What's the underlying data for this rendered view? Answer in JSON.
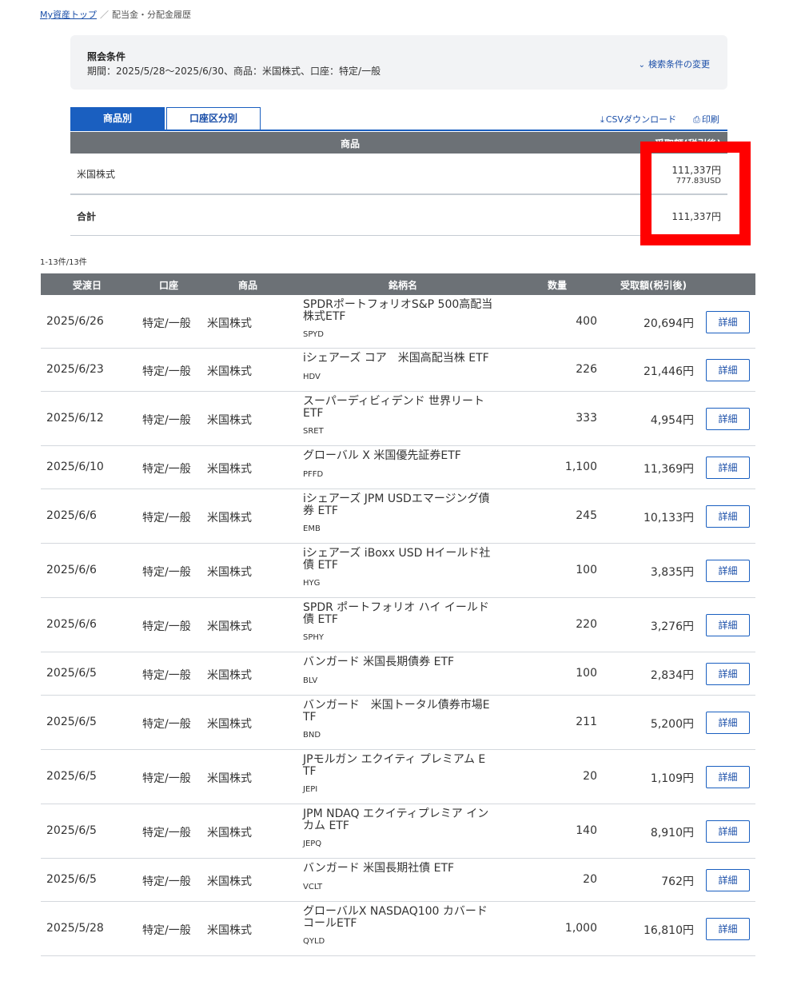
{
  "breadcrumb": {
    "home": "My資産トップ",
    "separator": "／",
    "current": "配当金・分配金履歴"
  },
  "conditions": {
    "title": "照会条件",
    "text": "期間：2025/5/28～2025/6/30、商品：米国株式、口座：特定/一般",
    "change_label": "検索条件の変更"
  },
  "tabs": [
    {
      "label": "商品別",
      "active": true
    },
    {
      "label": "口座区分別",
      "active": false
    }
  ],
  "actions": {
    "csv_label": "CSVダウンロード",
    "print_label": "印刷"
  },
  "summary": {
    "col_product": "商品",
    "col_amount": "受取額(税引後)",
    "row_product": "米国株式",
    "row_amount_jpy": "111,337円",
    "row_amount_usd": "777.83USD",
    "total_label": "合計",
    "total_amount": "111,337円"
  },
  "list": {
    "count": "1-13件/13件",
    "headers": {
      "date": "受渡日",
      "account": "口座",
      "product": "商品",
      "name": "銘柄名",
      "qty": "数量",
      "amount": "受取額(税引後)"
    },
    "detail_label": "詳細",
    "rows": [
      {
        "date": "2025/6/26",
        "account": "特定/一般",
        "product": "米国株式",
        "name1": "SPDRポートフォリオS&P 500高配当",
        "name2": "株式ETF",
        "code": "SPYD",
        "qty": "400",
        "amount": "20,694円"
      },
      {
        "date": "2025/6/23",
        "account": "特定/一般",
        "product": "米国株式",
        "name1": "iシェアーズ コア　米国高配当株 ETF",
        "name2": "",
        "code": "HDV",
        "qty": "226",
        "amount": "21,446円"
      },
      {
        "date": "2025/6/12",
        "account": "特定/一般",
        "product": "米国株式",
        "name1": "スーパーディビィデンド 世界リート",
        "name2": "ETF",
        "code": "SRET",
        "qty": "333",
        "amount": "4,954円"
      },
      {
        "date": "2025/6/10",
        "account": "特定/一般",
        "product": "米国株式",
        "name1": "グローバル X 米国優先証券ETF",
        "name2": "",
        "code": "PFFD",
        "qty": "1,100",
        "amount": "11,369円"
      },
      {
        "date": "2025/6/6",
        "account": "特定/一般",
        "product": "米国株式",
        "name1": "iシェアーズ JPM USDエマージング債",
        "name2": "券 ETF",
        "code": "EMB",
        "qty": "245",
        "amount": "10,133円"
      },
      {
        "date": "2025/6/6",
        "account": "特定/一般",
        "product": "米国株式",
        "name1": "iシェアーズ iBoxx USD Hイールド社",
        "name2": "債 ETF",
        "code": "HYG",
        "qty": "100",
        "amount": "3,835円"
      },
      {
        "date": "2025/6/6",
        "account": "特定/一般",
        "product": "米国株式",
        "name1": "SPDR ポートフォリオ ハイ イールド",
        "name2": "債 ETF",
        "code": "SPHY",
        "qty": "220",
        "amount": "3,276円"
      },
      {
        "date": "2025/6/5",
        "account": "特定/一般",
        "product": "米国株式",
        "name1": "バンガード 米国長期債券 ETF",
        "name2": "",
        "code": "BLV",
        "qty": "100",
        "amount": "2,834円"
      },
      {
        "date": "2025/6/5",
        "account": "特定/一般",
        "product": "米国株式",
        "name1": "バンガード　米国トータル債券市場E",
        "name2": "TF",
        "code": "BND",
        "qty": "211",
        "amount": "5,200円"
      },
      {
        "date": "2025/6/5",
        "account": "特定/一般",
        "product": "米国株式",
        "name1": "JPモルガン エクイティ プレミアム E",
        "name2": "TF",
        "code": "JEPI",
        "qty": "20",
        "amount": "1,109円"
      },
      {
        "date": "2025/6/5",
        "account": "特定/一般",
        "product": "米国株式",
        "name1": "JPM NDAQ エクイティプレミア イン",
        "name2": "カム ETF",
        "code": "JEPQ",
        "qty": "140",
        "amount": "8,910円"
      },
      {
        "date": "2025/6/5",
        "account": "特定/一般",
        "product": "米国株式",
        "name1": "バンガード 米国長期社債 ETF",
        "name2": "",
        "code": "VCLT",
        "qty": "20",
        "amount": "762円"
      },
      {
        "date": "2025/5/28",
        "account": "特定/一般",
        "product": "米国株式",
        "name1": "グローバルX NASDAQ100 カバード",
        "name2": "コールETF",
        "code": "QYLD",
        "qty": "1,000",
        "amount": "16,810円"
      }
    ]
  }
}
